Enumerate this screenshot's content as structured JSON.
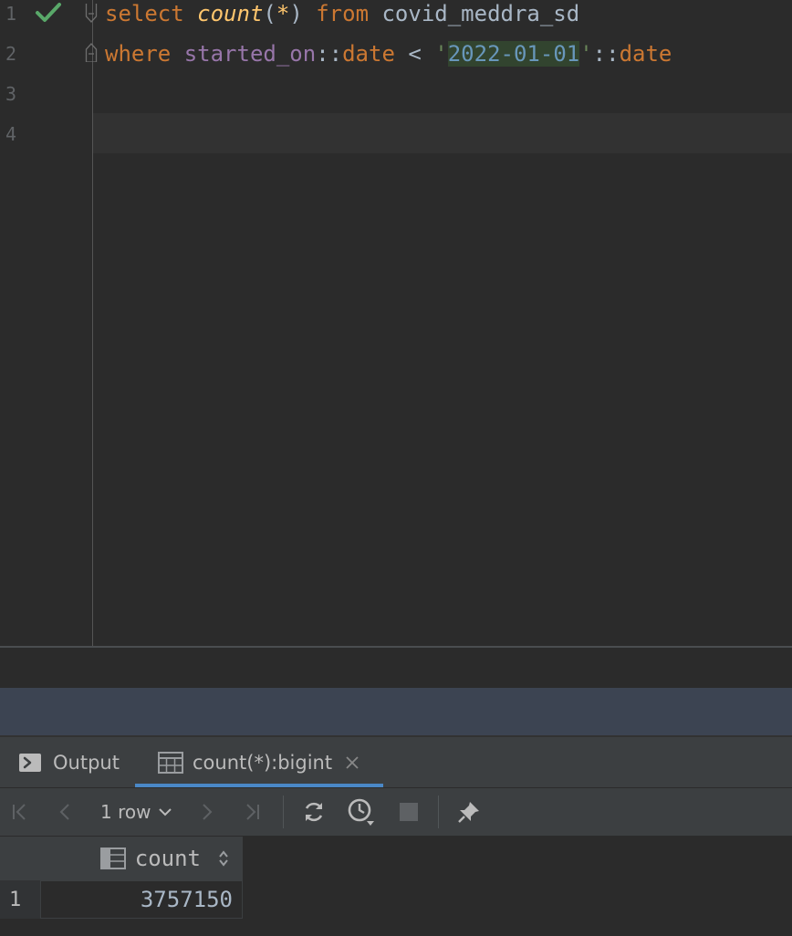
{
  "editor": {
    "line_numbers": [
      "1",
      "2",
      "3",
      "4"
    ],
    "line1": {
      "kw_select": "select",
      "fn_count": "count",
      "paren_open": "(",
      "star": "*",
      "paren_close": ")",
      "kw_from": "from",
      "table": "covid_meddra_sd"
    },
    "line2": {
      "kw_where": "where",
      "column": "started_on",
      "cast1": "::",
      "type1": "date",
      "lt": "<",
      "quote_open": "'",
      "date_value": "2022-01-01",
      "quote_close": "'",
      "cast2": "::",
      "type2": "date"
    },
    "status_icon": "check-icon"
  },
  "tabs": [
    {
      "label": "Output",
      "icon": "console-icon"
    },
    {
      "label": "count(*):bigint",
      "icon": "table-icon",
      "active": true
    }
  ],
  "toolbar": {
    "rows_label": "1 row"
  },
  "grid": {
    "columns": [
      {
        "label": "count",
        "icon": "column-icon"
      }
    ],
    "rows": [
      {
        "num": "1",
        "values": [
          "3757150"
        ]
      }
    ]
  },
  "colors": {
    "keyword": "#cc7832",
    "function": "#ffc66d",
    "column": "#9876aa",
    "string": "#6a8759",
    "accent": "#4a88c7",
    "check": "#59a869"
  }
}
